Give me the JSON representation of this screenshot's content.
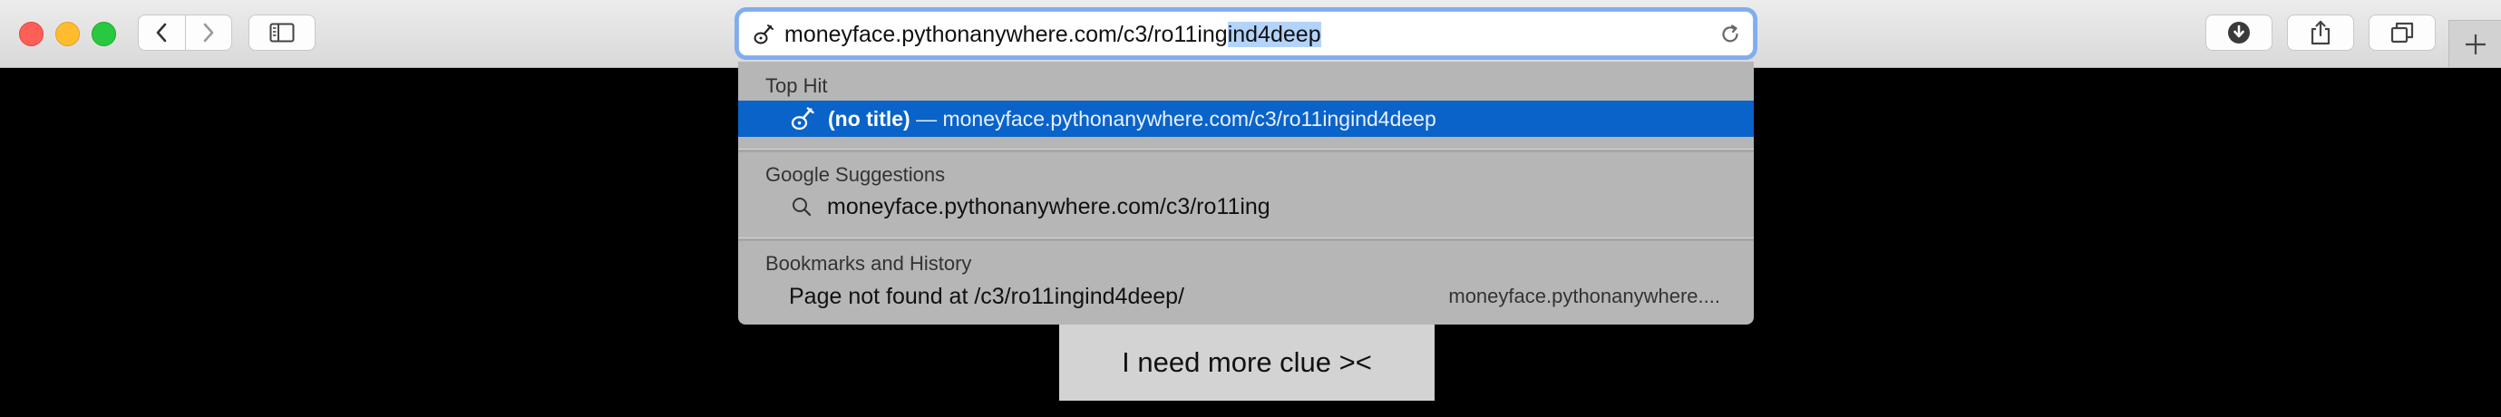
{
  "address_bar": {
    "typed": "moneyface.pythonanywhere.com/c3/ro11ing",
    "autocomplete": "ind4deep"
  },
  "dropdown": {
    "top_hit": {
      "header": "Top Hit",
      "title": "(no title)",
      "separator": " — ",
      "url": "moneyface.pythonanywhere.com/c3/ro11ingind4deep"
    },
    "google": {
      "header": "Google Suggestions",
      "suggestion": "moneyface.pythonanywhere.com/c3/ro11ing"
    },
    "history": {
      "header": "Bookmarks and History",
      "title": "Page not found at /c3/ro11ingind4deep/",
      "url": "moneyface.pythonanywhere...."
    }
  },
  "page": {
    "clue_text": "I need more clue ><"
  },
  "colors": {
    "selection_row": "#0a63c8",
    "focus_ring": "#7fadf0",
    "page_background": "#000000"
  },
  "icons": [
    "back-icon",
    "forward-icon",
    "sidebar-icon",
    "lute-favicon-icon",
    "reload-icon",
    "download-icon",
    "share-icon",
    "tabs-icon",
    "plus-icon",
    "search-icon"
  ]
}
